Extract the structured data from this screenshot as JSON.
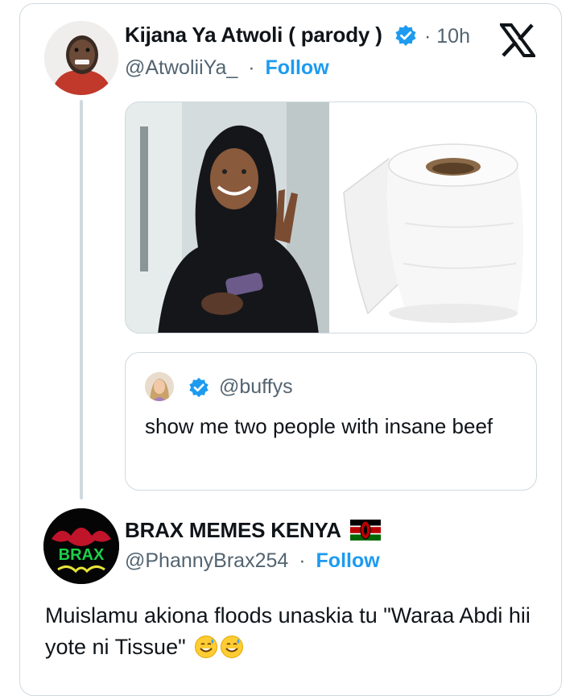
{
  "tweet": {
    "display_name": "Kijana Ya Atwoli ( parody )",
    "handle": "@AtwoliiYa_",
    "separator": "·",
    "follow_label": "Follow",
    "time": "· 10h",
    "platform_icon": "x-logo-icon",
    "verified_icon": "verified-badge-icon"
  },
  "quoted": {
    "handle": "@buffys",
    "text": "show me two people with insane beef"
  },
  "reply": {
    "display_name": "BRAX MEMES KENYA",
    "flag": "kenya-flag-icon",
    "handle": "@PhannyBrax254",
    "separator": "·",
    "follow_label": "Follow",
    "text": "Muislamu akiona floods unaskia tu \"Waraa Abdi hii yote ni Tissue\"",
    "emoji_icon": "sweat-smile-emoji-icon",
    "avatar_text": "BRAX"
  },
  "colors": {
    "accent": "#1d9bf0",
    "border": "#cfd9de",
    "muted": "#536471"
  }
}
